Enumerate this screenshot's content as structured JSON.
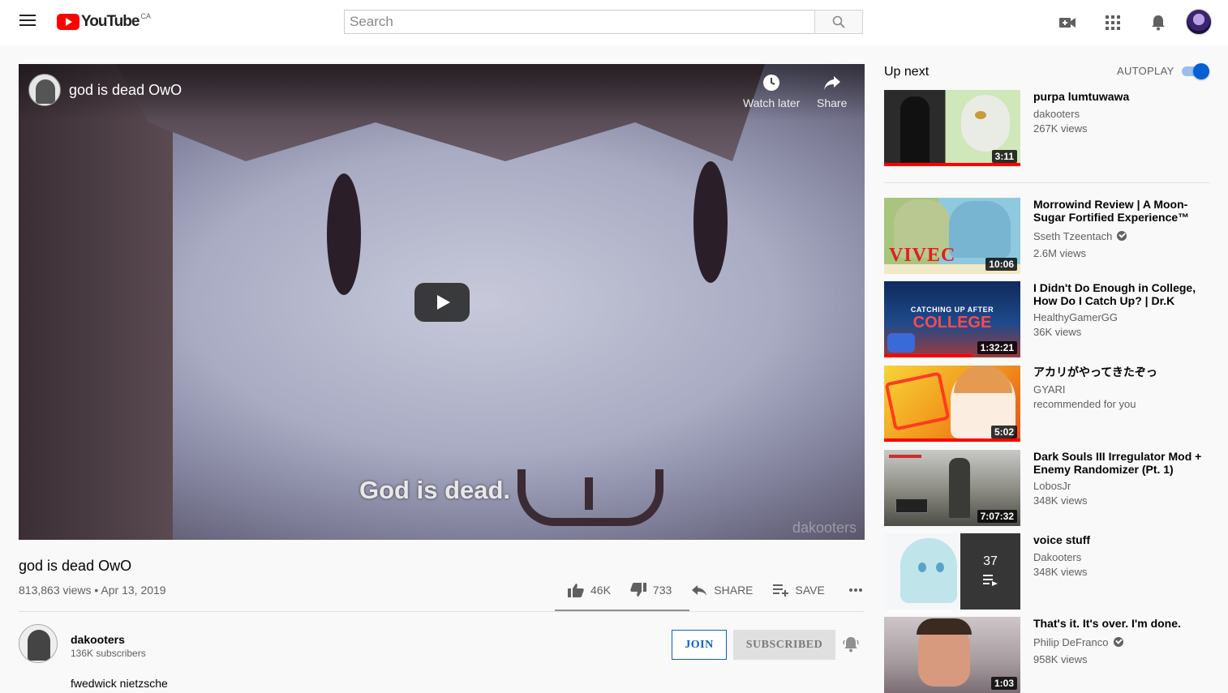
{
  "masthead": {
    "logo_text": "YouTube",
    "country": "CA",
    "search_placeholder": "Search"
  },
  "player": {
    "overlay_title": "god is dead OwO",
    "watch_later": "Watch later",
    "share": "Share",
    "caption_in_frame": "God is dead.",
    "watermark": "dakooters"
  },
  "video": {
    "title": "god is dead OwO",
    "meta": "813,863 views • Apr 13, 2019",
    "likes": "46K",
    "dislikes": "733",
    "share": "SHARE",
    "save": "SAVE",
    "like_ratio": 0.98
  },
  "owner": {
    "name": "dakooters",
    "subscribers": "136K subscribers",
    "description": "fwedwick nietzsche",
    "join": "JOIN",
    "subscribed": "SUBSCRIBED"
  },
  "sidebar": {
    "up_next": "Up next",
    "autoplay": "AUTOPLAY",
    "autoplay_on": true,
    "items": [
      {
        "title": "purpa lumtuwawa",
        "channel": "dakooters",
        "views": "267K views",
        "duration": "3:11",
        "progress": 1.0,
        "verified": false
      },
      {
        "title": "Morrowind Review | A Moon-Sugar Fortified Experience™",
        "channel": "Sseth Tzeentach",
        "views": "2.6M views",
        "duration": "10:06",
        "progress": 0.0,
        "verified": true,
        "thumb_text": "VIVEC"
      },
      {
        "title": "I Didn't Do Enough in College, How Do I Catch Up? | Dr.K",
        "channel": "HealthyGamerGG",
        "views": "36K views",
        "duration": "1:32:21",
        "progress": 0.65,
        "verified": false,
        "thumb_text_1": "CATCHING UP AFTER",
        "thumb_text_2": "COLLEGE"
      },
      {
        "title": "アカリがやってきたぞっ",
        "channel": "GYARI",
        "views": "recommended for you",
        "duration": "5:02",
        "progress": 1.0,
        "verified": false
      },
      {
        "title": "Dark Souls III Irregulator Mod + Enemy Randomizer (Pt. 1)",
        "channel": "LobosJr",
        "views": "348K views",
        "duration": "7:07:32",
        "progress": 0.0,
        "verified": false
      },
      {
        "title": "voice stuff",
        "channel": "Dakooters",
        "views": "348K views",
        "playlist_count": "37",
        "verified": false
      },
      {
        "title": "That's it. It's over. I'm done.",
        "channel": "Philip DeFranco",
        "views": "958K views",
        "duration": "1:03",
        "progress": 0.0,
        "verified": true
      }
    ]
  },
  "colors": {
    "brand_red": "#ff0000",
    "link_blue": "#065fd4",
    "secondary_text": "#606060"
  }
}
